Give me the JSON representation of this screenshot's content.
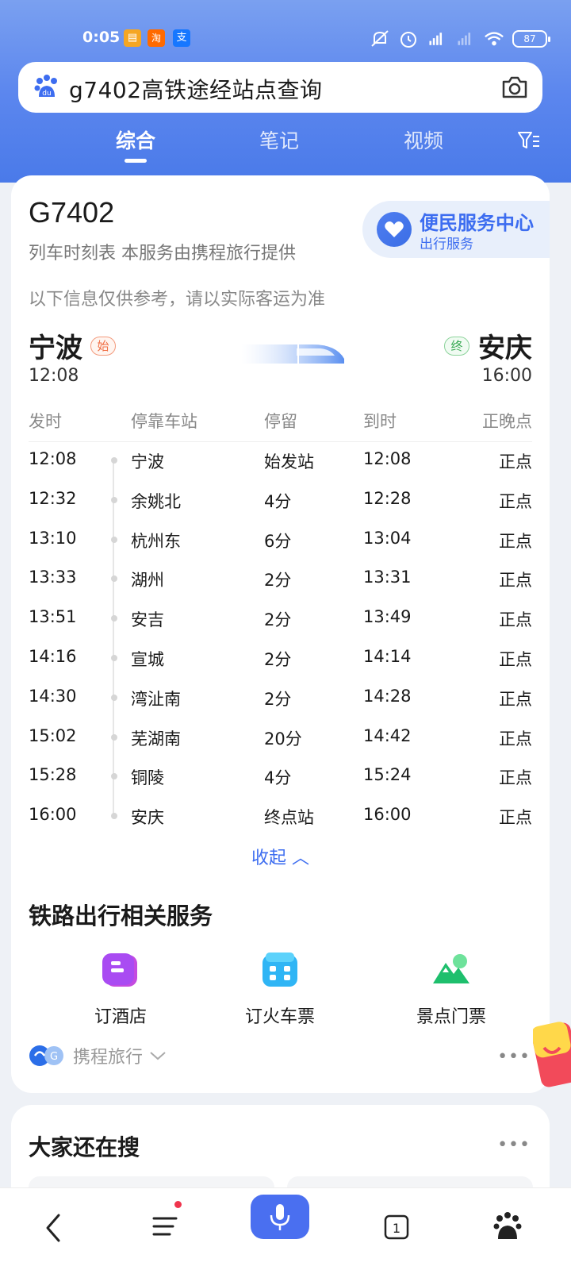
{
  "status_bar": {
    "time": "0:05",
    "battery": "87",
    "apps": [
      "taobao-like-app",
      "taobao",
      "alipay"
    ]
  },
  "search": {
    "query": "g7402高铁途经站点查询"
  },
  "tabs": [
    {
      "label": "综合",
      "active": true
    },
    {
      "label": "笔记",
      "active": false
    },
    {
      "label": "视频",
      "active": false
    }
  ],
  "train": {
    "number": "G7402",
    "subtitle": "列车时刻表 本服务由携程旅行提供",
    "notice": "以下信息仅供参考，请以实际客运为准",
    "service_title": "便民服务中心",
    "service_sub": "出行服务",
    "from_station": "宁波",
    "from_badge": "始",
    "from_time": "12:08",
    "to_station": "安庆",
    "to_badge": "终",
    "to_time": "16:00"
  },
  "table": {
    "headers": [
      "发时",
      "停靠车站",
      "停留",
      "到时",
      "正晚点"
    ],
    "rows": [
      [
        "12:08",
        "宁波",
        "始发站",
        "12:08",
        "正点"
      ],
      [
        "12:32",
        "余姚北",
        "4分",
        "12:28",
        "正点"
      ],
      [
        "13:10",
        "杭州东",
        "6分",
        "13:04",
        "正点"
      ],
      [
        "13:33",
        "湖州",
        "2分",
        "13:31",
        "正点"
      ],
      [
        "13:51",
        "安吉",
        "2分",
        "13:49",
        "正点"
      ],
      [
        "14:16",
        "宣城",
        "2分",
        "14:14",
        "正点"
      ],
      [
        "14:30",
        "湾沚南",
        "2分",
        "14:28",
        "正点"
      ],
      [
        "15:02",
        "芜湖南",
        "20分",
        "14:42",
        "正点"
      ],
      [
        "15:28",
        "铜陵",
        "4分",
        "15:24",
        "正点"
      ],
      [
        "16:00",
        "安庆",
        "终点站",
        "16:00",
        "正点"
      ]
    ]
  },
  "collapse_label": "收起 ︿",
  "services": {
    "title": "铁路出行相关服务",
    "items": [
      {
        "label": "订酒店",
        "icon": "hotel-icon"
      },
      {
        "label": "订火车票",
        "icon": "train-ticket-icon"
      },
      {
        "label": "景点门票",
        "icon": "scenic-ticket-icon"
      }
    ],
    "provider": "携程旅行"
  },
  "related": {
    "title": "大家还在搜"
  },
  "colors": {
    "accent": "#3d6df0",
    "badge_start": "#f07046",
    "badge_end": "#3aaa55"
  }
}
